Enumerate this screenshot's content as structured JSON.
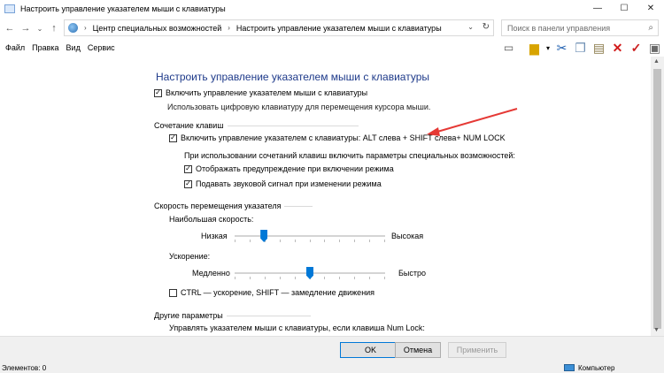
{
  "window": {
    "title": "Настроить управление указателем мыши с клавиатуры",
    "controls": {
      "minimize": "—",
      "maximize": "☐",
      "close": "✕"
    }
  },
  "addressbar": {
    "crumbs": [
      "Центр специальных возможностей",
      "Настроить управление указателем мыши с клавиатуры"
    ],
    "separator": "›"
  },
  "search": {
    "placeholder": "Поиск в панели управления"
  },
  "menu": {
    "items": [
      "Файл",
      "Правка",
      "Вид",
      "Сервис"
    ]
  },
  "page": {
    "heading": "Настроить управление указателем мыши с клавиатуры",
    "enable_mousekeys": {
      "label": "Включить управление указателем мыши с клавиатуры",
      "checked": true
    },
    "enable_hint": "Использовать цифровую клавиатуру для перемещения курсора мыши.",
    "shortcut_section": {
      "title": "Сочетание клавиш",
      "enable_shortcut": {
        "label": "Включить управление указателем с клавиатуры: ALT слева + SHIFT слева+ NUM LOCK",
        "checked": true
      },
      "params_text": "При использовании сочетаний клавиш включить параметры специальных возможностей:",
      "show_warning": {
        "label": "Отображать предупреждение при включении режима",
        "checked": true
      },
      "play_sound": {
        "label": "Подавать звуковой сигнал при изменении режима",
        "checked": true
      }
    },
    "speed_section": {
      "title": "Скорость перемещения указателя",
      "top_speed": {
        "label": "Наибольшая скорость:",
        "min_label": "Низкая",
        "max_label": "Высокая",
        "value": 0.18
      },
      "acceleration": {
        "label": "Ускорение:",
        "min_label": "Медленно",
        "max_label": "Быстро",
        "value": 0.5
      },
      "ctrl_shift": {
        "label": "CTRL — ускорение, SHIFT — замедление движения",
        "checked": false
      }
    },
    "other_section": {
      "title": "Другие параметры",
      "numlock_text": "Управлять указателем мыши с клавиатуры, если клавиша Num Lock:"
    }
  },
  "buttons": {
    "ok": "OK",
    "cancel": "Отмена",
    "apply": "Применить"
  },
  "status": {
    "items": "Элементов: 0",
    "location": "Компьютер"
  },
  "colors": {
    "heading": "#1e3a8a",
    "accent": "#0078d7",
    "annotation_arrow": "#e53935"
  }
}
